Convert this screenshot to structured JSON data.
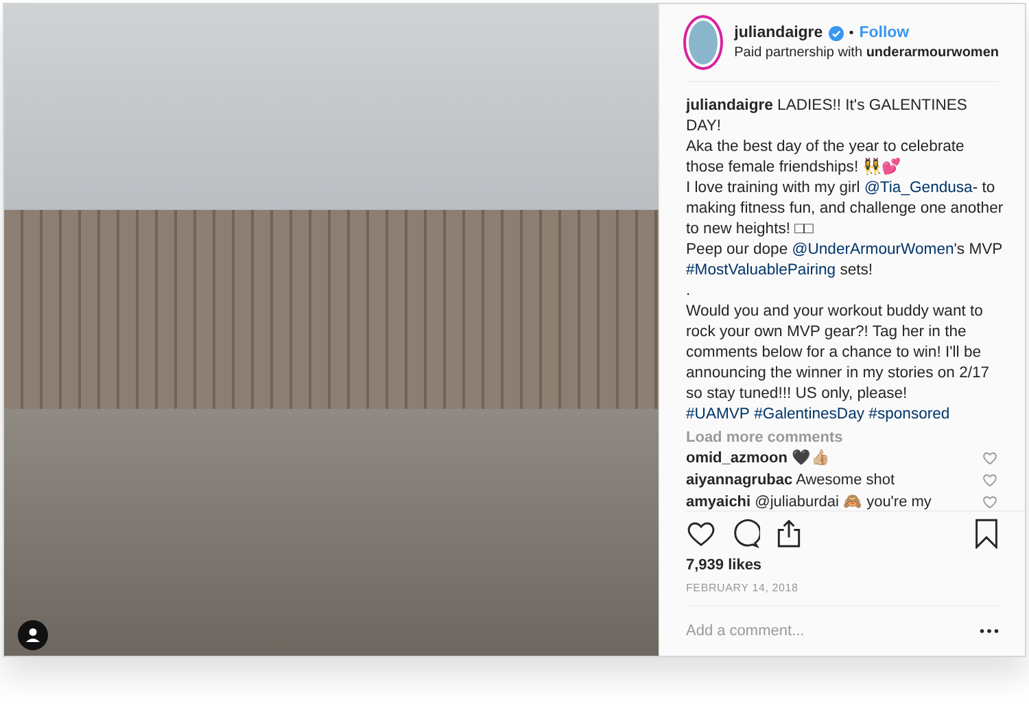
{
  "author": {
    "username": "juliandaigre",
    "verified": true,
    "separator": "•",
    "follow": "Follow",
    "partnership_prefix": "Paid partnership with",
    "partner": "underarmourwomen"
  },
  "caption": {
    "username": "juliandaigre",
    "segments": [
      {
        "kind": "text",
        "text": " LADIES!! It's GALENTINES DAY!\nAka the best day of the year to celebrate those female friendships! 👯‍♀️💕\nI love training with my girl "
      },
      {
        "kind": "link",
        "text": "@Tia_Gendusa"
      },
      {
        "kind": "text",
        "text": "- to making fitness fun, and challenge one another to new heights! □□\nPeep our dope "
      },
      {
        "kind": "link",
        "text": "@UnderArmourWomen"
      },
      {
        "kind": "text",
        "text": "'s MVP "
      },
      {
        "kind": "link",
        "text": "#MostValuablePairing"
      },
      {
        "kind": "text",
        "text": " sets!\n.\nWould you and your workout buddy want to rock your own MVP gear?! Tag her in the comments below for a chance to win! I'll be announcing the winner in my stories on 2/17 so stay tuned!!! US only, please!\n"
      },
      {
        "kind": "tag",
        "text": "#UAMVP"
      },
      {
        "kind": "tag",
        "text": "#GalentinesDay"
      },
      {
        "kind": "link",
        "text": "#sponsored"
      }
    ]
  },
  "load_more": "Load more comments",
  "comments": [
    {
      "username": "omid_azmoon",
      "text": "🖤👍🏼"
    },
    {
      "username": "aiyannagrubac",
      "text": "Awesome shot"
    },
    {
      "username": "amyaichi",
      "text": "@juliaburdai 🙈 you're my"
    }
  ],
  "likes": "7,939 likes",
  "date": "FEBRUARY 14, 2018",
  "comment_placeholder": "Add a comment..."
}
